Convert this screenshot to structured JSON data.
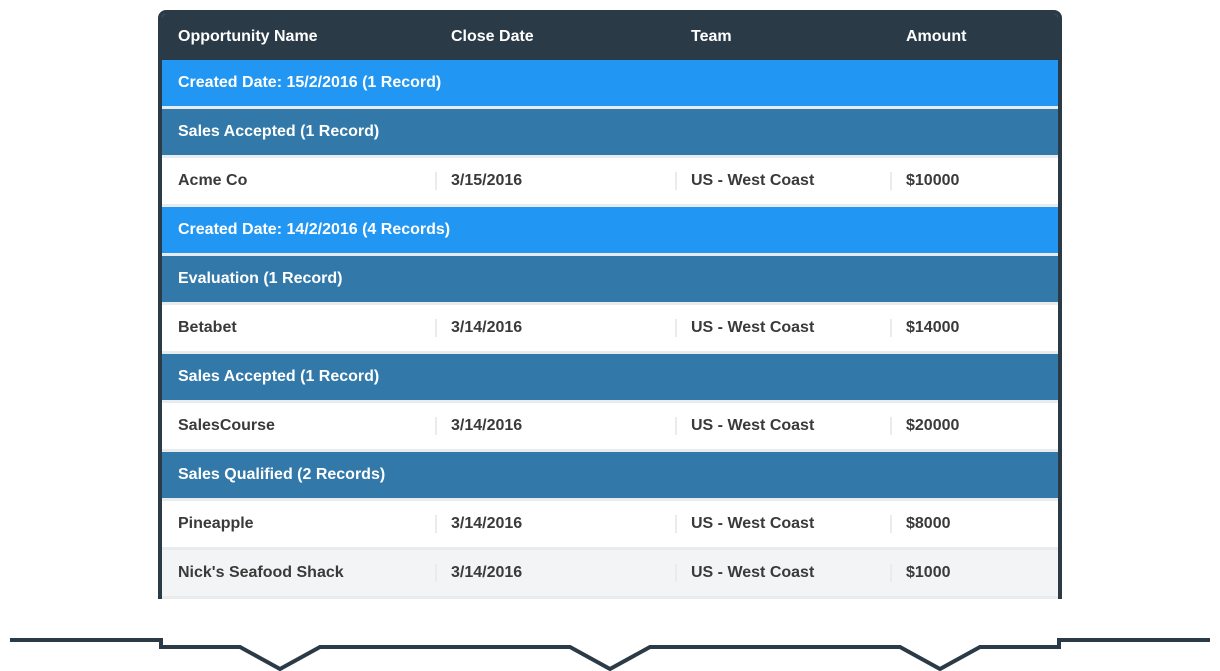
{
  "headers": {
    "opportunity": "Opportunity Name",
    "closeDate": "Close Date",
    "team": "Team",
    "amount": "Amount"
  },
  "groups": [
    {
      "label": "Created Date: 15/2/2016 (1 Record)",
      "subgroups": [
        {
          "label": "Sales Accepted (1 Record)",
          "rows": [
            {
              "opportunity": "Acme Co",
              "closeDate": "3/15/2016",
              "team": "US - West Coast",
              "amount": "$10000",
              "alt": false
            }
          ]
        }
      ]
    },
    {
      "label": "Created Date: 14/2/2016 (4 Records)",
      "subgroups": [
        {
          "label": "Evaluation (1 Record)",
          "rows": [
            {
              "opportunity": "Betabet",
              "closeDate": "3/14/2016",
              "team": "US - West Coast",
              "amount": "$14000",
              "alt": false
            }
          ]
        },
        {
          "label": "Sales Accepted (1 Record)",
          "rows": [
            {
              "opportunity": "SalesCourse",
              "closeDate": "3/14/2016",
              "team": "US - West Coast",
              "amount": "$20000",
              "alt": false
            }
          ]
        },
        {
          "label": "Sales Qualified (2 Records)",
          "rows": [
            {
              "opportunity": "Pineapple",
              "closeDate": "3/14/2016",
              "team": "US - West Coast",
              "amount": "$8000",
              "alt": false
            },
            {
              "opportunity": "Nick's Seafood Shack",
              "closeDate": "3/14/2016",
              "team": "US - West Coast",
              "amount": "$1000",
              "alt": true
            }
          ]
        }
      ]
    }
  ]
}
